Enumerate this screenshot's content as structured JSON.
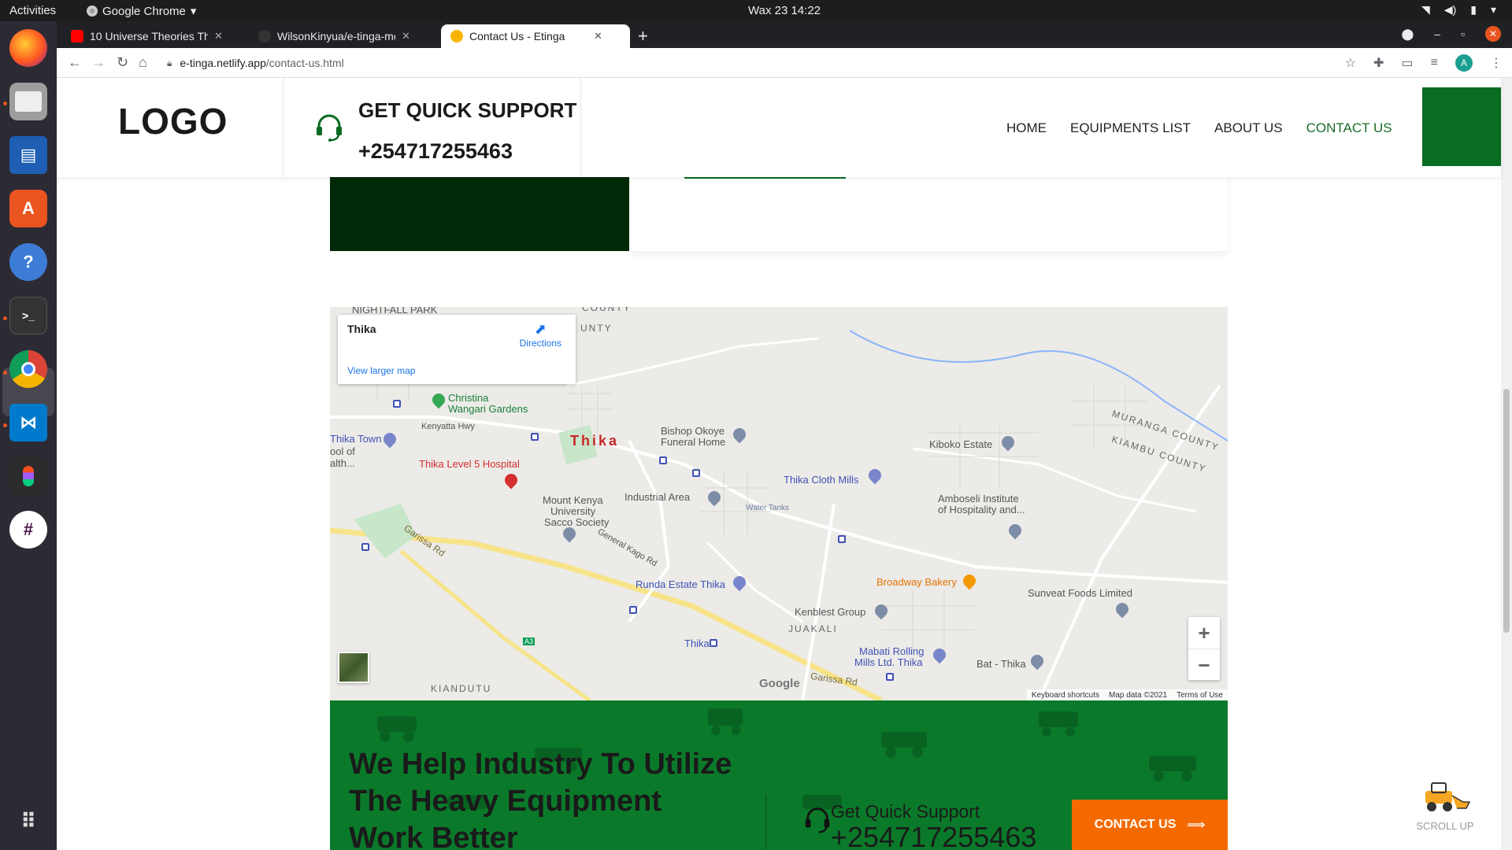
{
  "os": {
    "activities": "Activities",
    "app_name": "Google Chrome",
    "clock": "Wax 23  14:22"
  },
  "browser": {
    "tabs": [
      {
        "title": "10 Universe Theories That"
      },
      {
        "title": "WilsonKinyua/e-tinga-mo"
      },
      {
        "title": "Contact Us - Etinga"
      }
    ],
    "url_host": "e-tinga.netlify.app",
    "url_path": "/contact-us.html",
    "profile_initial": "A"
  },
  "header": {
    "logo": "LOGO",
    "support_title": "GET QUICK SUPPORT",
    "support_phone": "+254717255463",
    "nav": [
      {
        "label": "HOME"
      },
      {
        "label": "EQUIPMENTS LIST"
      },
      {
        "label": "ABOUT US"
      },
      {
        "label": "CONTACT US"
      }
    ]
  },
  "map": {
    "place_name": "Thika",
    "directions": "Directions",
    "view_larger": "View larger map",
    "labels": {
      "nightfall": "NIGHTFALL PARK",
      "county_top": "COUNTY",
      "county_top2": "UNTY",
      "christina": "Christina",
      "wangari": "Wangari Gardens",
      "kenyatta": "Kenyatta Hwy",
      "thika_town": "Thika Town",
      "school": "ool of",
      "health": "alth...",
      "thika": "Thika",
      "hospital": "Thika Level 5 Hospital",
      "bishop1": "Bishop Okoye",
      "bishop2": "Funeral Home",
      "kiboko": "Kiboko Estate",
      "muranga": "MURANGA COUNTY",
      "kiambu": "KIAMBU COUNTY",
      "cloth_mills": "Thika Cloth Mills",
      "mku1": "Mount Kenya",
      "mku2": "University",
      "mku3": "Sacco Society",
      "industrial": "Industrial Area",
      "water_tanks": "Water Tanks",
      "amboseli1": "Amboseli Institute",
      "amboseli2": "of Hospitality and...",
      "garissa": "Garissa Rd",
      "general_kago": "General Kago Rd",
      "runda": "Runda Estate Thika",
      "broadway": "Broadway Bakery",
      "sunveat": "Sunveat Foods Limited",
      "kenblest": "Kenblest Group",
      "juakali": "JUAKALI",
      "thika_bus": "Thika",
      "mabati1": "Mabati Rolling",
      "mabati2": "Mills Ltd. Thika",
      "bat": "Bat - Thika",
      "kianduttu": "KIANDUTU",
      "garissa2": "Garissa Rd",
      "a3": "A3"
    },
    "google": "Google",
    "keyboard": "Keyboard shortcuts",
    "map_data": "Map data ©2021",
    "terms": "Terms of Use",
    "zoom_in": "+",
    "zoom_out": "−"
  },
  "cta": {
    "heading": "We Help Industry To Utilize The Heavy Equipment Work Better",
    "support_label": "Get Quick Support",
    "phone": "+254717255463",
    "button": "CONTACT US"
  },
  "scroll_up": "SCROLL UP",
  "colors": {
    "brand_green": "#0a6b23",
    "cta_green": "#0a7a2a",
    "orange": "#f56a00"
  }
}
